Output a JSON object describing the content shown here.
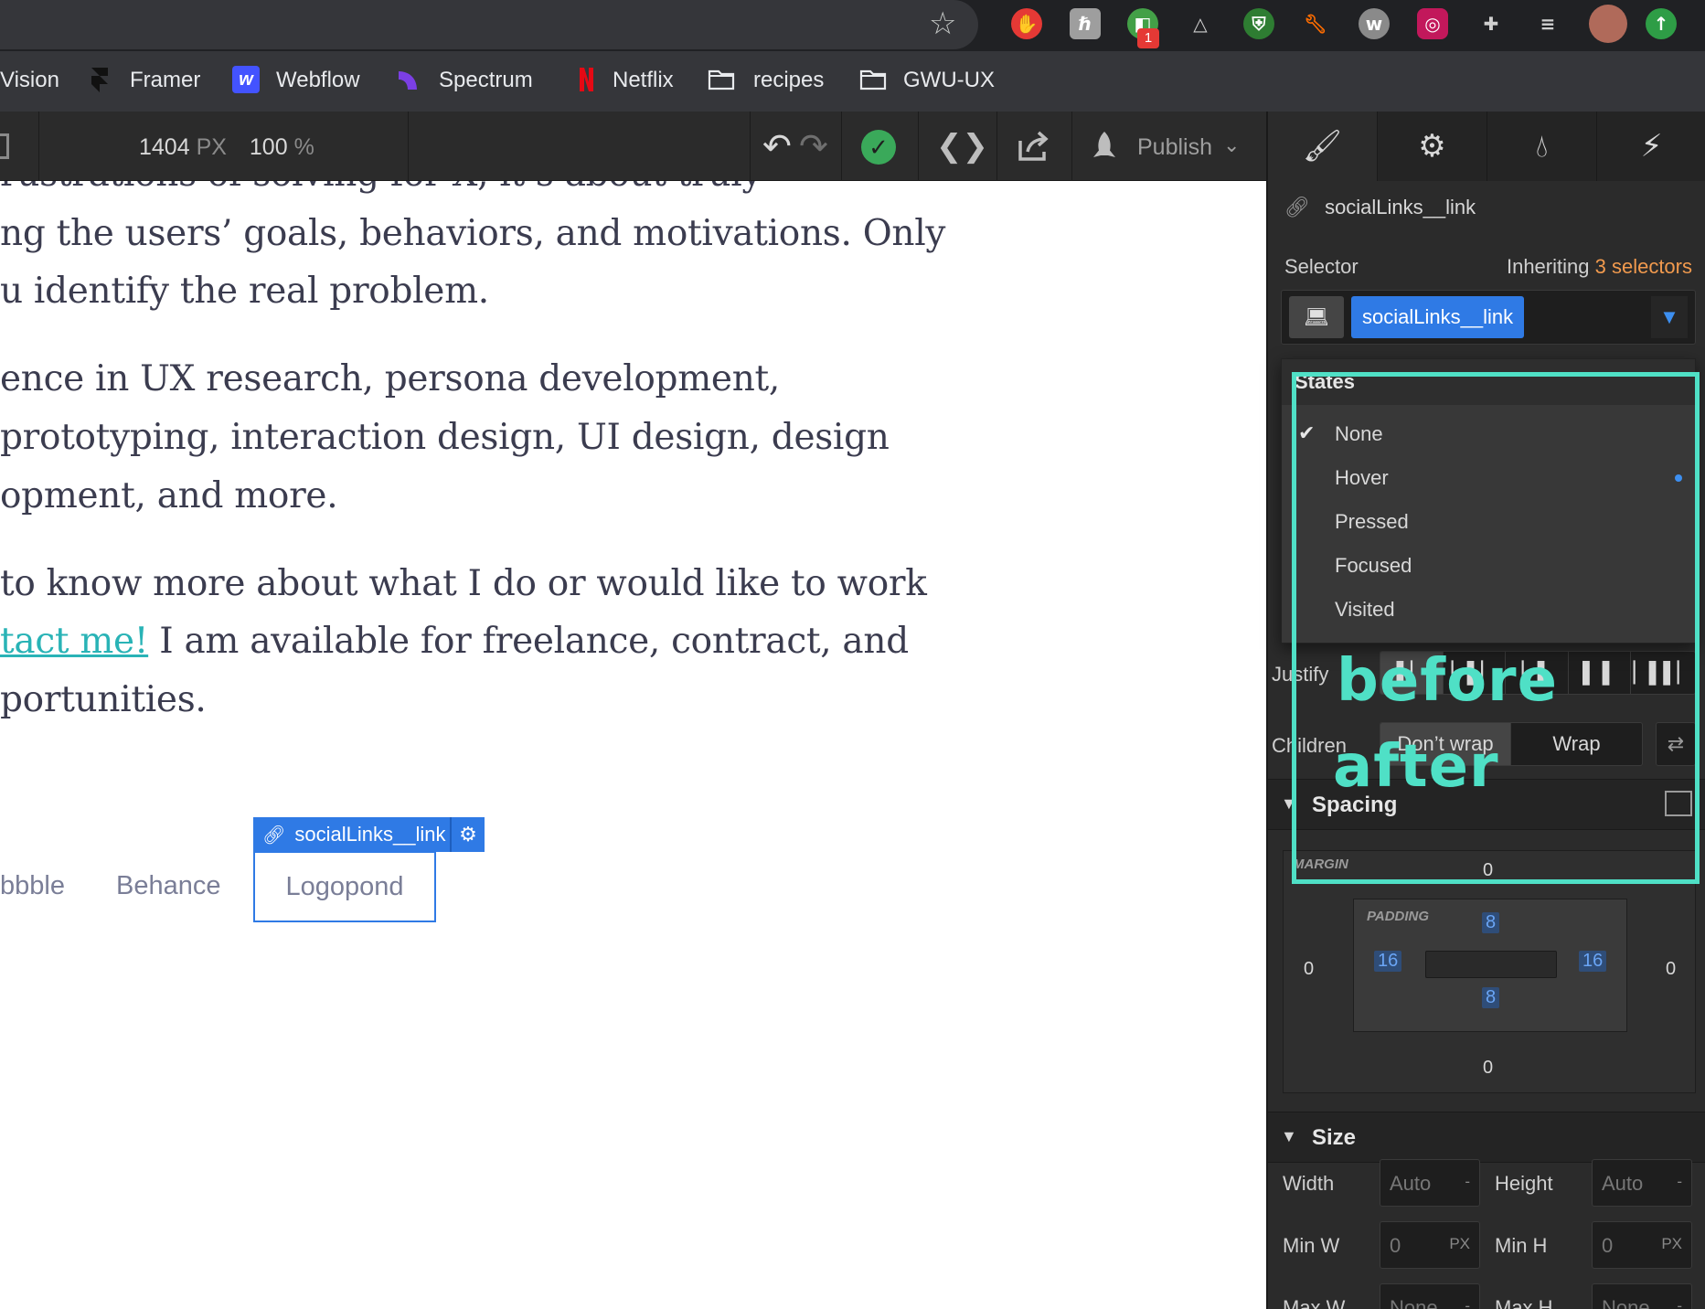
{
  "bookmarks": [
    {
      "label": "Vision"
    },
    {
      "label": "Framer"
    },
    {
      "label": "Webflow"
    },
    {
      "label": "Spectrum"
    },
    {
      "label": "Netflix"
    },
    {
      "label": "recipes"
    },
    {
      "label": "GWU-UX"
    }
  ],
  "extensions": {
    "badge_count": "1"
  },
  "toolbar": {
    "width_value": "1404",
    "width_unit": "PX",
    "zoom_value": "100",
    "zoom_unit": "%",
    "publish_label": "Publish"
  },
  "canvas": {
    "paragraphs": [
      "rustrations of solving for X, it’s about truly",
      "ng the users’ goals, behaviors, and motivations. Only",
      "u identify the real problem.",
      "ence in UX research, persona development,",
      " prototyping, interaction design, UI design, design",
      "opment, and more.",
      "to know more about what I do or would like to work",
      "I am available for freelance, contract, and",
      "portunities."
    ],
    "contact_link": "tact me!",
    "social_links": [
      "bbble",
      "Behance",
      "Logopond"
    ],
    "selection_tag": "socialLinks__link"
  },
  "panel": {
    "element_name": "socialLinks__link",
    "selector_label": "Selector",
    "inheriting_prefix": "Inheriting",
    "inheriting_count": "3 selectors",
    "selector_chip": "socialLinks__link",
    "states_title": "States",
    "states": [
      "None",
      "Hover",
      "Pressed",
      "Focused",
      "Visited"
    ],
    "justify_label": "Justify",
    "children_label": "Children",
    "wrap_options": [
      "Don’t wrap",
      "Wrap"
    ],
    "spacing_title": "Spacing",
    "margin_label": "MARGIN",
    "padding_label": "PADDING",
    "margin": {
      "top": "0",
      "right": "0",
      "bottom": "0",
      "left": "0"
    },
    "padding": {
      "top": "8",
      "right": "16",
      "bottom": "8",
      "left": "16"
    },
    "size_title": "Size",
    "size": {
      "width_label": "Width",
      "width_value": "Auto",
      "height_label": "Height",
      "height_value": "Auto",
      "minw_label": "Min W",
      "minw_value": "0",
      "minh_label": "Min H",
      "minh_value": "0",
      "maxw_label": "Max W",
      "maxw_value": "None",
      "maxh_label": "Max H",
      "maxh_value": "None",
      "unit_px": "PX",
      "dash": "-"
    }
  },
  "annotations": {
    "before": "before",
    "after": "after"
  },
  "colors": {
    "accent": "#2f7ae5",
    "annotation": "#4fe0c6",
    "link": "#29b3b6",
    "inherit": "#f19a4e"
  }
}
